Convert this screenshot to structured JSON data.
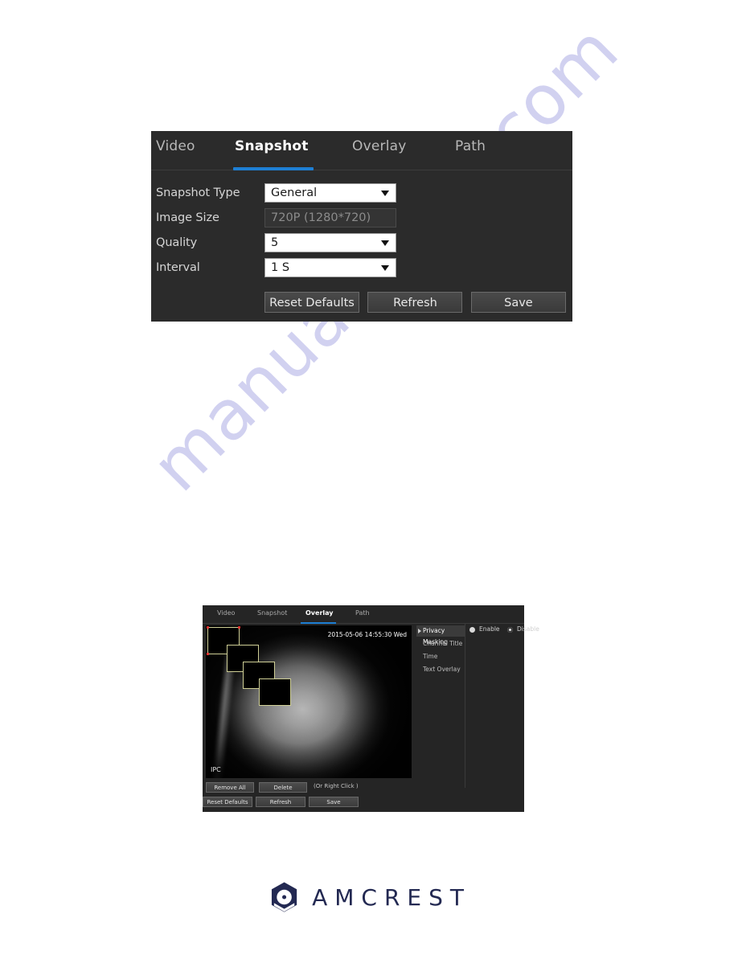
{
  "page": {
    "background_color": "#ffffff",
    "watermark_text": "manualshive.com",
    "watermark_color": "#c9c9ee"
  },
  "snapshot_panel": {
    "panel_background": "#2b2b2b",
    "accent_color": "#1e7fd4",
    "tabs": [
      {
        "label": "Video",
        "active": false
      },
      {
        "label": "Snapshot",
        "active": true
      },
      {
        "label": "Overlay",
        "active": false
      },
      {
        "label": "Path",
        "active": false
      }
    ],
    "fields": [
      {
        "label": "Snapshot Type",
        "value": "General",
        "type": "select"
      },
      {
        "label": "Image Size",
        "value": "720P (1280*720)",
        "type": "readonly"
      },
      {
        "label": "Quality",
        "value": "5",
        "type": "select"
      },
      {
        "label": "Interval",
        "value": "1 S",
        "type": "select"
      }
    ],
    "buttons": [
      {
        "label": "Reset Defaults"
      },
      {
        "label": "Refresh"
      },
      {
        "label": "Save"
      }
    ]
  },
  "overlay_panel": {
    "panel_background": "#252525",
    "accent_color": "#1e7fd4",
    "tabs": [
      {
        "label": "Video",
        "active": false
      },
      {
        "label": "Snapshot",
        "active": false
      },
      {
        "label": "Overlay",
        "active": true
      },
      {
        "label": "Path",
        "active": false
      }
    ],
    "video": {
      "timestamp": "2015-05-06 14:55:30 Wed",
      "channel_title": "IPC",
      "mask_count": 4,
      "mask_border_color": "#cfcf96"
    },
    "options": [
      {
        "label": "Privacy Masking",
        "selected": true
      },
      {
        "label": "Channel Title",
        "selected": false
      },
      {
        "label": "Time",
        "selected": false
      },
      {
        "label": "Text Overlay",
        "selected": false
      }
    ],
    "radios": [
      {
        "label": "Enable",
        "checked": false
      },
      {
        "label": "Disable",
        "checked": true
      }
    ],
    "mask_buttons": [
      {
        "label": "Remove All"
      },
      {
        "label": "Delete"
      }
    ],
    "mask_hint": "(Or Right Click )",
    "action_buttons": [
      {
        "label": "Reset Defaults"
      },
      {
        "label": "Refresh"
      },
      {
        "label": "Save"
      }
    ]
  },
  "footer": {
    "brand": "AMCREST",
    "brand_color": "#232952"
  }
}
